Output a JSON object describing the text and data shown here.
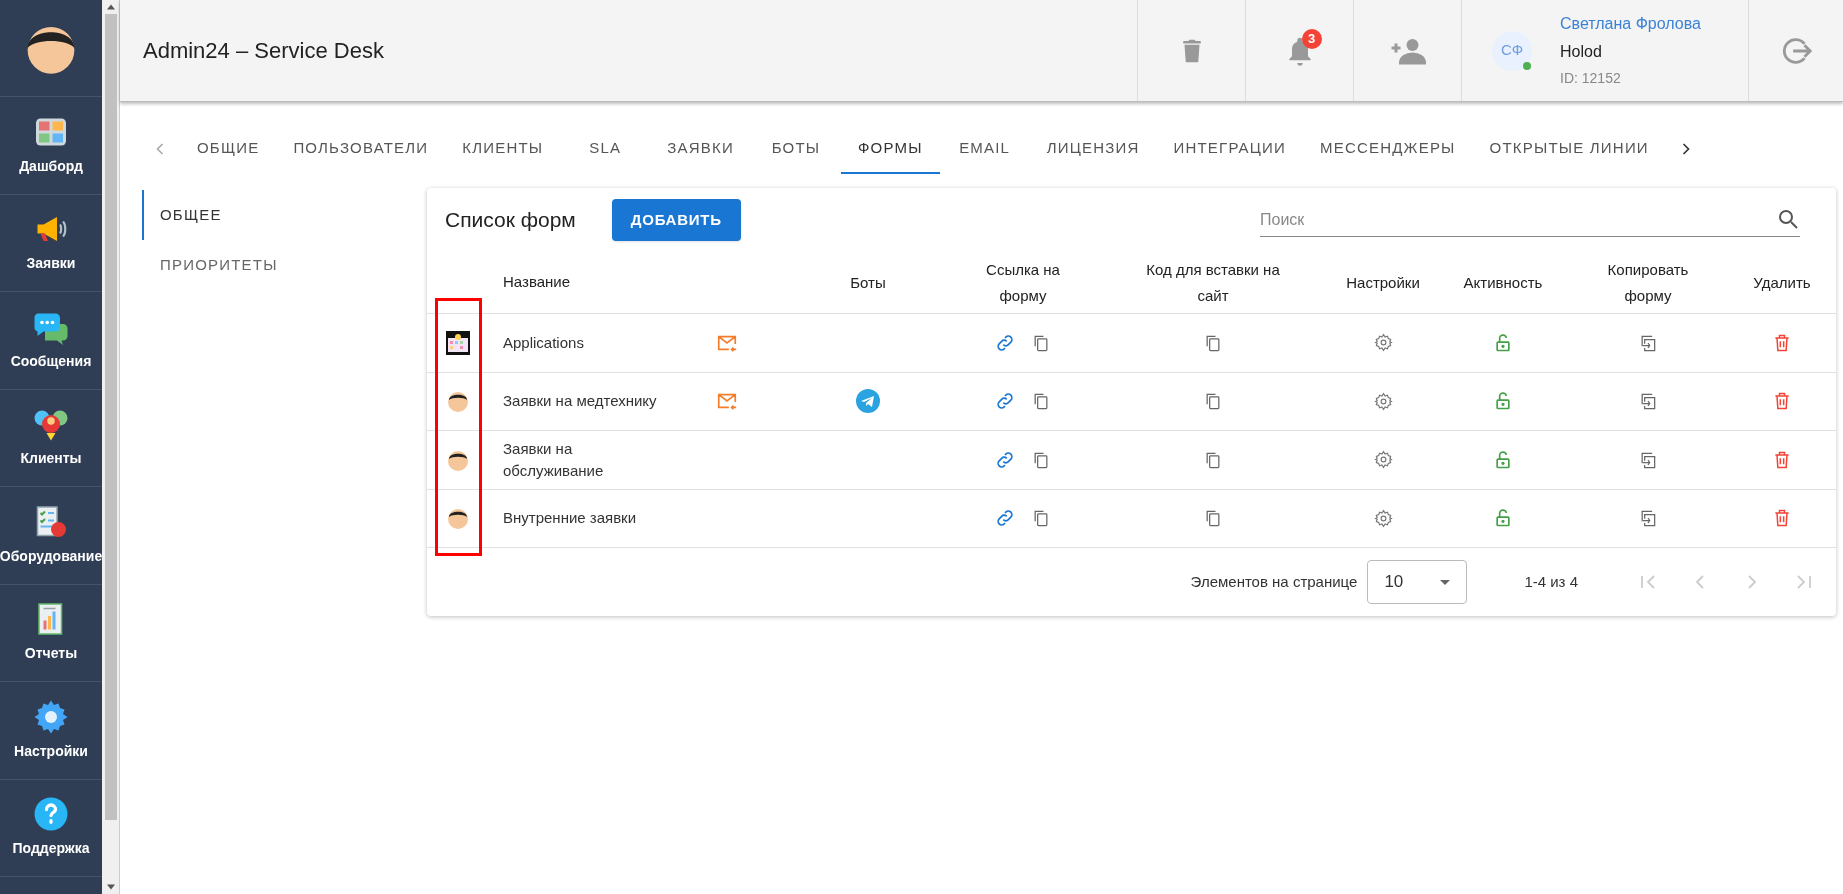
{
  "sidebar": {
    "items": [
      {
        "label": "Дашборд",
        "kind": "dashboard"
      },
      {
        "label": "Заявки",
        "kind": "megaphone"
      },
      {
        "label": "Сообщения",
        "kind": "chat"
      },
      {
        "label": "Клиенты",
        "kind": "clients"
      },
      {
        "label": "Оборудование",
        "kind": "equipment"
      },
      {
        "label": "Отчеты",
        "kind": "reports"
      },
      {
        "label": "Настройки",
        "kind": "settings"
      },
      {
        "label": "Поддержка",
        "kind": "help"
      }
    ]
  },
  "header": {
    "title": "Admin24 – Service Desk",
    "notifications": "3",
    "user": {
      "initials": "СФ",
      "online": true,
      "name": "Светлана Фролова",
      "company": "Holod",
      "id": "ID: 12152"
    }
  },
  "tabs": [
    {
      "label": "ОБЩИЕ",
      "selected": false
    },
    {
      "label": "ПОЛЬЗОВАТЕЛИ",
      "selected": false
    },
    {
      "label": "КЛИЕНТЫ",
      "selected": false
    },
    {
      "label": "SLA",
      "selected": false
    },
    {
      "label": "ЗАЯВКИ",
      "selected": false
    },
    {
      "label": "БОТЫ",
      "selected": false
    },
    {
      "label": "ФОРМЫ",
      "selected": true
    },
    {
      "label": "EMAIL",
      "selected": false
    },
    {
      "label": "ЛИЦЕНЗИЯ",
      "selected": false
    },
    {
      "label": "ИНТЕГРАЦИИ",
      "selected": false
    },
    {
      "label": "МЕССЕНДЖЕРЫ",
      "selected": false
    },
    {
      "label": "ОТКРЫТЫЕ ЛИНИИ",
      "selected": false
    }
  ],
  "subnav": [
    {
      "label": "ОБЩЕЕ",
      "selected": true
    },
    {
      "label": "ПРИОРИТЕТЫ",
      "selected": false
    }
  ],
  "forms_panel": {
    "title": "Список форм",
    "add_button": "ДОБАВИТЬ",
    "search": {
      "placeholder": "Поиск"
    },
    "columns": [
      "Название",
      "Боты",
      "Ссылка на форму",
      "Код для вставки на сайт",
      "Настройки",
      "Активность",
      "Копировать форму",
      "Удалить"
    ],
    "rows": [
      {
        "kind": "board",
        "name": "Applications",
        "email": true,
        "telegram": false,
        "active": true
      },
      {
        "kind": "face",
        "name": "Заявки на медтехнику",
        "email": true,
        "telegram": true,
        "active": true
      },
      {
        "kind": "face",
        "name": "Заявки на обслуживание",
        "email": false,
        "telegram": false,
        "active": true
      },
      {
        "kind": "face",
        "name": "Внутренние заявки",
        "email": false,
        "telegram": false,
        "active": true
      }
    ],
    "highlight": true,
    "pagination": {
      "label": "Элементов на странице",
      "per_page": "10",
      "range": "1-4 из 4"
    }
  }
}
